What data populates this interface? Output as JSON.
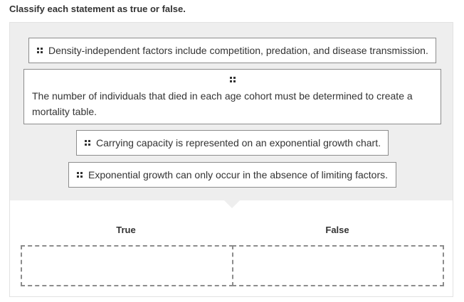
{
  "instruction": "Classify each statement as true or false.",
  "statements": [
    "Density-independent factors include competition, predation, and disease transmission.",
    "The number of individuals that died in each age cohort must be determined to create a mortality table.",
    "Carrying capacity is represented on an exponential growth chart.",
    "Exponential growth can only occur in the absence of limiting factors."
  ],
  "categories": [
    {
      "label": "True"
    },
    {
      "label": "False"
    }
  ]
}
